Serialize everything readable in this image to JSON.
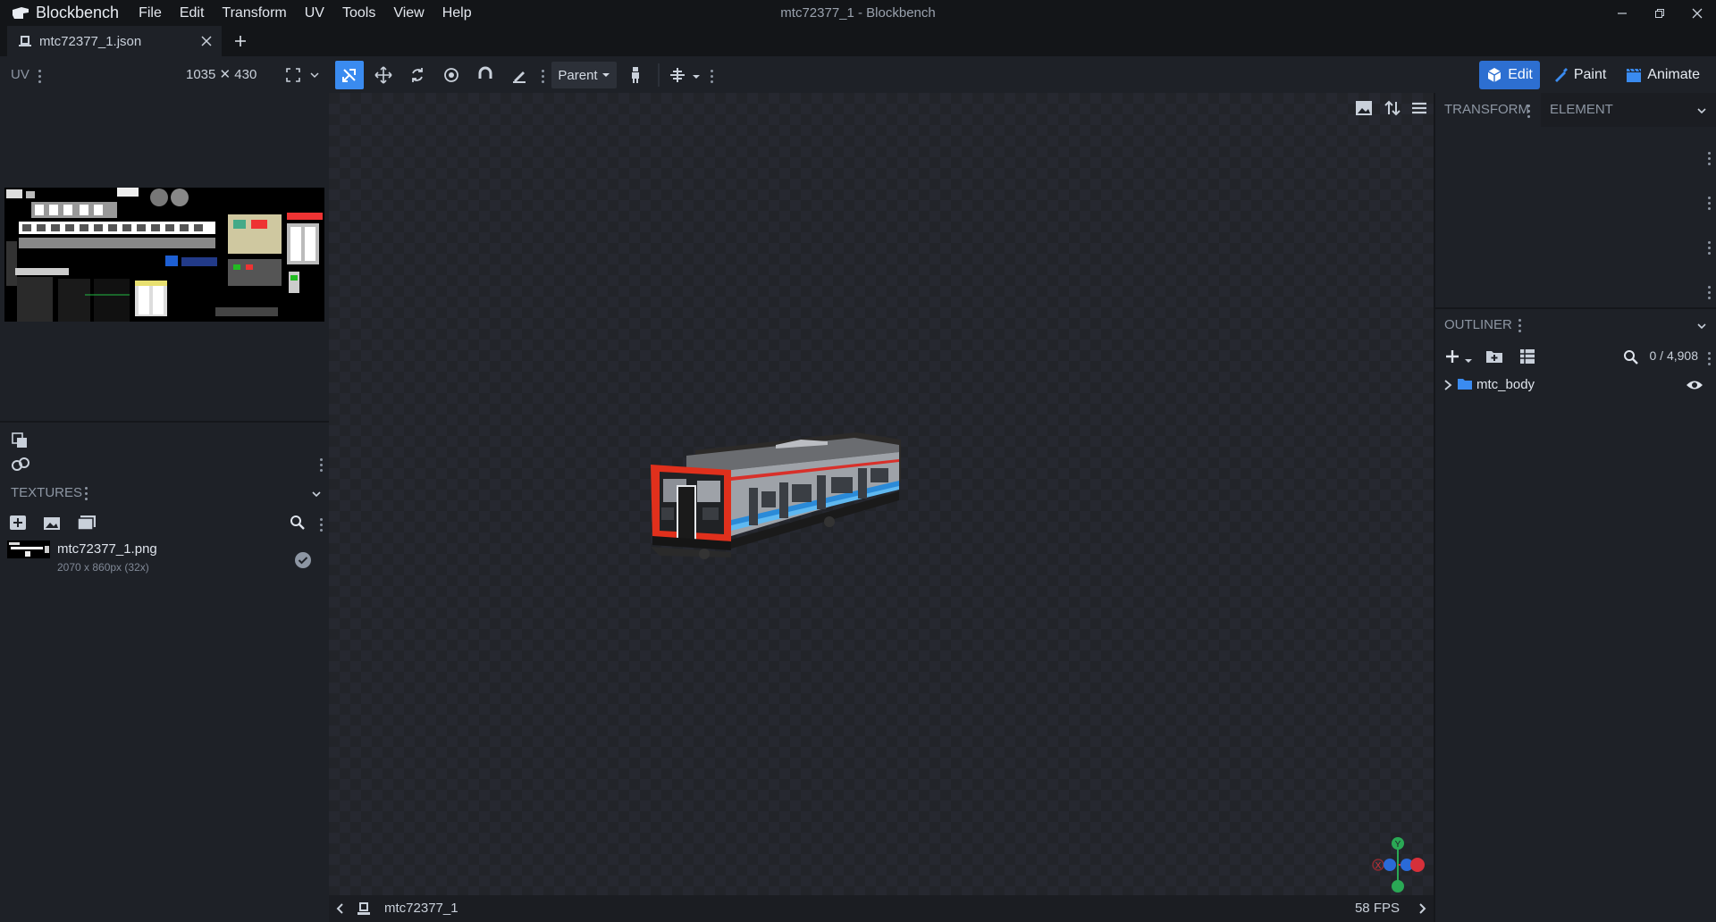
{
  "app": {
    "name": "Blockbench",
    "window_title": "mtc72377_1 - Blockbench"
  },
  "menu": [
    "File",
    "Edit",
    "Transform",
    "UV",
    "Tools",
    "View",
    "Help"
  ],
  "tab": {
    "label": "mtc72377_1.json"
  },
  "toolbar": {
    "uv_label": "UV",
    "uv_size": "1035 ✕ 430",
    "pivot_select": "Parent"
  },
  "modes": {
    "edit": "Edit",
    "paint": "Paint",
    "animate": "Animate",
    "active": "edit"
  },
  "textures": {
    "title": "TEXTURES",
    "items": [
      {
        "name": "mtc72377_1.png",
        "meta": "2070 x 860px (32x)"
      }
    ]
  },
  "right_panel": {
    "tabs": [
      "TRANSFORM",
      "ELEMENT"
    ],
    "outliner": {
      "title": "OUTLINER",
      "count": "0 / 4,908",
      "items": [
        {
          "name": "mtc_body"
        }
      ]
    }
  },
  "viewport": {
    "model_name": "mtc72377_1",
    "fps": "58 FPS"
  },
  "gizmo": {
    "y": "Y",
    "x": "X"
  },
  "colors": {
    "accent": "#3a8bf0",
    "panel": "#1e2127",
    "titlebar": "#131518",
    "train_red": "#e0301c",
    "train_blue": "#2a8ad8"
  }
}
